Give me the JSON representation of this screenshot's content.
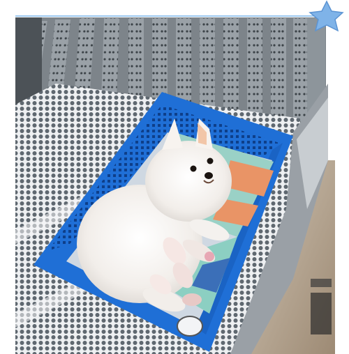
{
  "image": {
    "subject": "white-pomeranian-with-puppies",
    "icon": "star-icon",
    "colors": {
      "frame_line": "#9cc8ef",
      "star": "#7fb3e8",
      "basket": "#1f6fd6",
      "basket_dark": "#1556b3",
      "floor_grate": "#d9dde2",
      "rack_steel": "#8e949a",
      "dog_fur": "#f4f1ee",
      "blanket_teal": "#9ad1c6",
      "blanket_orange": "#e99466",
      "wall_right": "#b7a58f"
    }
  }
}
